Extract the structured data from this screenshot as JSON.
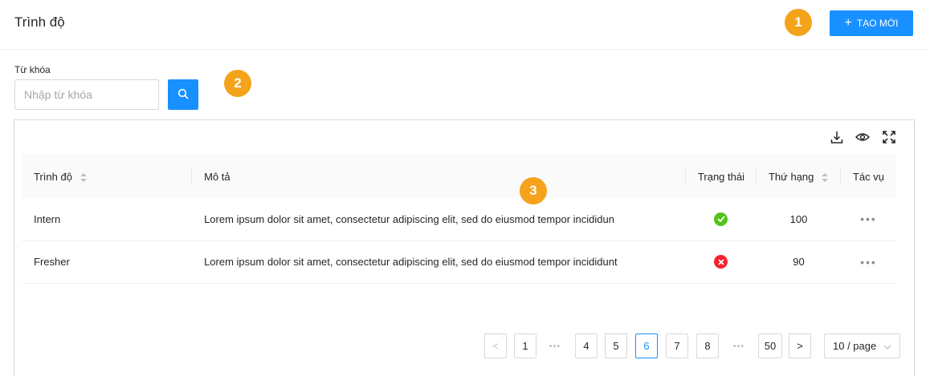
{
  "header": {
    "title": "Trình độ",
    "create_label": "TẠO MỚI"
  },
  "badges": [
    "1",
    "2",
    "3"
  ],
  "search": {
    "label": "Từ khóa",
    "placeholder": "Nhập từ khóa"
  },
  "toolbar": {
    "icons": [
      "download-icon",
      "eye-icon",
      "fullscreen-icon"
    ]
  },
  "table": {
    "columns": [
      "Trình độ",
      "Mô tả",
      "Trạng thái",
      "Thứ hạng",
      "Tác vụ"
    ],
    "rows": [
      {
        "level": "Intern",
        "description": "Lorem ipsum dolor sit amet, consectetur adipiscing elit, sed do eiusmod tempor incididun",
        "status": "active",
        "rank": "100",
        "actions": "•••"
      },
      {
        "level": "Fresher",
        "description": "Lorem ipsum dolor sit amet, consectetur adipiscing elit, sed do eiusmod tempor incididunt",
        "status": "inactive",
        "rank": "90",
        "actions": "•••"
      }
    ]
  },
  "pagination": {
    "prev": "<",
    "next": ">",
    "ellipsis": "•••",
    "pages": [
      "1",
      "4",
      "5",
      "6",
      "7",
      "8",
      "50"
    ],
    "current": "6",
    "page_size": "10 / page"
  },
  "colors": {
    "primary": "#1890ff",
    "badge": "#f4a31a",
    "success": "#52c41a",
    "error": "#f5222d"
  }
}
